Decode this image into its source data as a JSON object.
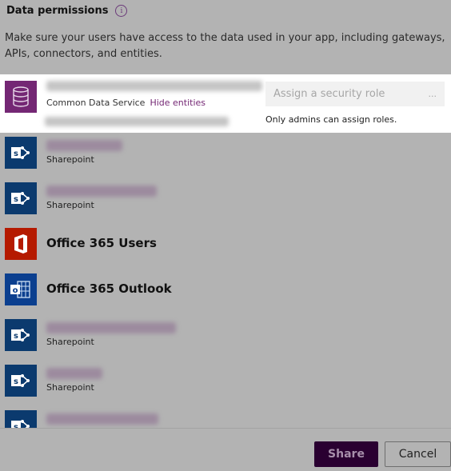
{
  "header": {
    "title": "Data permissions",
    "info_icon": "info-icon"
  },
  "description": "Make sure your users have access to the data used in your app, including gateways, APIs, connectors, and entities.",
  "cds": {
    "icon": "database-icon",
    "name_blurred": true,
    "type": "Common Data Service",
    "hide_link": "Hide entities",
    "role_placeholder": "Assign a security role",
    "role_ellipsis": "...",
    "role_note": "Only admins can assign roles."
  },
  "connections": [
    {
      "icon": "sharepoint-icon",
      "name": "",
      "blurred": true,
      "type": "Sharepoint"
    },
    {
      "icon": "sharepoint-icon",
      "name": "",
      "blurred": true,
      "type": "Sharepoint"
    },
    {
      "icon": "office365-icon",
      "name": "Office 365 Users",
      "blurred": false,
      "type": ""
    },
    {
      "icon": "outlook-icon",
      "name": "Office 365 Outlook",
      "blurred": false,
      "type": ""
    },
    {
      "icon": "sharepoint-icon",
      "name": "",
      "blurred": true,
      "type": "Sharepoint"
    },
    {
      "icon": "sharepoint-icon",
      "name": "",
      "blurred": true,
      "type": "Sharepoint"
    },
    {
      "icon": "sharepoint-icon",
      "name": "",
      "blurred": true,
      "type": ""
    }
  ],
  "footer": {
    "share_label": "Share",
    "cancel_label": "Cancel"
  },
  "colors": {
    "accent": "#742774",
    "share_bg": "#2a0031",
    "overlay": "#b3b3b3"
  }
}
